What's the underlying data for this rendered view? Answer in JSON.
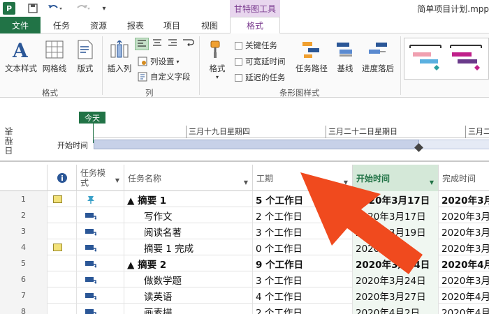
{
  "titlebar": {
    "app_icon": "P",
    "save_icon": "save-icon",
    "undo_icon": "undo-icon",
    "redo_icon": "redo-icon",
    "context_group": "甘特图工具",
    "window_title": "简单项目计划.mpp"
  },
  "tabs": {
    "file": "文件",
    "task": "任务",
    "resource": "资源",
    "report": "报表",
    "project": "项目",
    "view": "视图",
    "format": "格式"
  },
  "ribbon": {
    "text_styles": "文本样式",
    "gridlines": "网格线",
    "layout": "版式",
    "group_format": "格式",
    "insert_column": "插入列",
    "column_settings": "列设置",
    "custom_fields": "自定义字段",
    "group_columns": "列",
    "format_btn": "格式",
    "critical_tasks": "关键任务",
    "slack": "可宽延时间",
    "late_tasks": "延迟的任务",
    "task_path": "任务路径",
    "baseline": "基线",
    "slippage": "进度落后",
    "group_bar_styles": "条形图样式"
  },
  "timeline": {
    "side_label": "日程表",
    "today": "今天",
    "start_label": "开始时间",
    "ticks": [
      "三月十九日星期四",
      "三月二十二日星期日",
      "三月二"
    ]
  },
  "grid": {
    "headers": {
      "info_icon": "info-icon",
      "mode": "任务模式",
      "name": "任务名称",
      "duration": "工期",
      "start": "开始时间",
      "finish": "完成时间"
    },
    "rows": [
      {
        "id": "1",
        "name": "▲ 摘要 1",
        "duration": "5 个工作日",
        "start": "2020年3月17日",
        "finish": "2020年3月",
        "summary": true
      },
      {
        "id": "2",
        "name": "写作文",
        "duration": "2 个工作日",
        "start": "2020年3月17日",
        "finish": "2020年3月"
      },
      {
        "id": "3",
        "name": "阅读名著",
        "duration": "3 个工作日",
        "start": "2020年3月19日",
        "finish": "2020年3月"
      },
      {
        "id": "4",
        "name": "摘要 1 完成",
        "duration": "0 个工作日",
        "start": "2020年3月",
        "finish": "2020年3月"
      },
      {
        "id": "5",
        "name": "▲ 摘要 2",
        "duration": "9 个工作日",
        "start": "2020年3月24日",
        "finish": "2020年4月",
        "summary": true
      },
      {
        "id": "6",
        "name": "做数学题",
        "duration": "3 个工作日",
        "start": "2020年3月24日",
        "finish": "2020年3月"
      },
      {
        "id": "7",
        "name": "读英语",
        "duration": "4 个工作日",
        "start": "2020年3月27日",
        "finish": "2020年4月"
      },
      {
        "id": "8",
        "name": "画素描",
        "duration": "2 个工作日",
        "start": "2020年4月2日",
        "finish": "2020年4月"
      }
    ]
  },
  "colors": {
    "accent_green": "#217346",
    "context_purple": "#7a3b8f",
    "arrow_red": "#f04a1e"
  }
}
